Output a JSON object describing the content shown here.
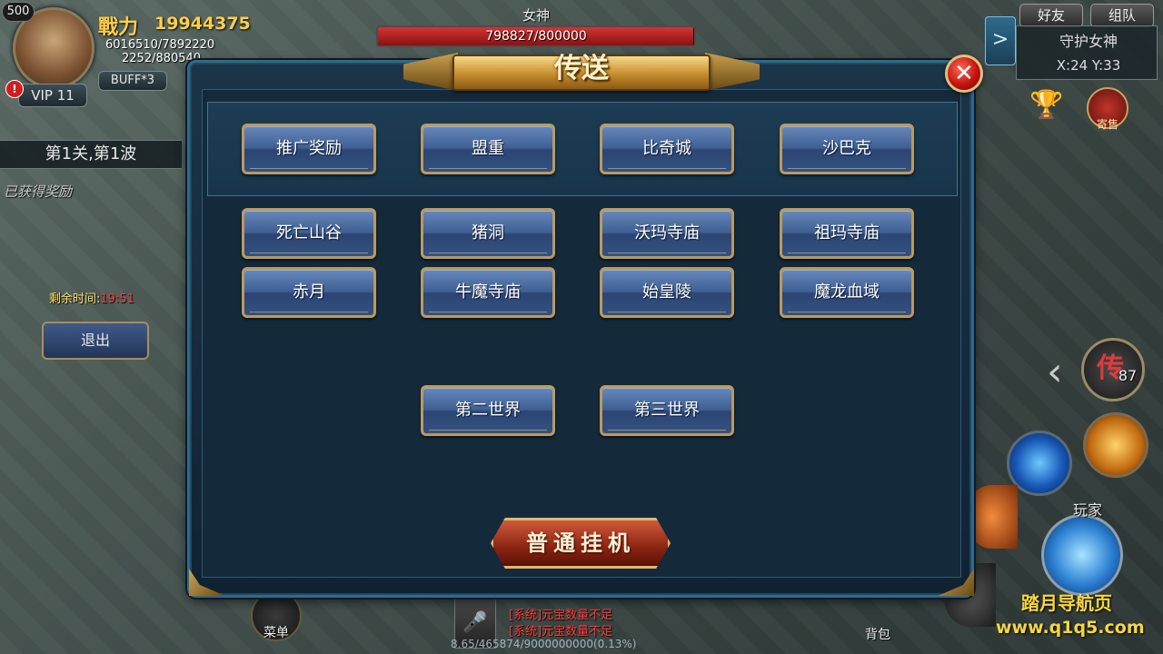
{
  "hud": {
    "level": "500",
    "power_label": "戰力",
    "power_value": "19944375",
    "hp": "6016510/7892220",
    "mp": "2252/880540",
    "vip": "VIP 11",
    "vip_alert": "!",
    "buff": "BUFF*3"
  },
  "boss": {
    "name": "女神",
    "hp_text": "798827/800000",
    "hp_fraction": 0.9985
  },
  "left_panel": {
    "stage": "第1关,第1波",
    "reward_status": "已获得奖励",
    "time_label": "剩余时间:",
    "time_value": "19:51",
    "exit_label": "退出"
  },
  "right_hud": {
    "friends": "好友",
    "team": "组队",
    "map_toggle": ">",
    "map_name": "守护女神",
    "coords": "X:24 Y:33",
    "consign_label": "寄售",
    "teleport_glyph": "传",
    "teleport_count": "87",
    "player_label": "玩家"
  },
  "dialog": {
    "title": "传送",
    "close_symbol": "✕",
    "top_row": [
      "推广奖励",
      "盟重",
      "比奇城",
      "沙巴克"
    ],
    "row2": [
      "死亡山谷",
      "猪洞",
      "沃玛寺庙",
      "祖玛寺庙"
    ],
    "row3": [
      "赤月",
      "牛魔寺庙",
      "始皇陵",
      "魔龙血域"
    ],
    "row4": [
      "第二世界",
      "第三世界"
    ],
    "hangup_label": "普通挂机"
  },
  "bottom": {
    "menu_label": "菜单",
    "bag_label": "背包",
    "chat": [
      "[系统]元宝数量不足",
      "[系统]元宝数量不足"
    ],
    "exp_text": "8.65/465874/9000000000(0.13%)"
  },
  "watermark": {
    "line1": "踏月导航页",
    "line2": "www.q1q5.com"
  },
  "colors": {
    "gold": "#ffcf4a",
    "button_blue": "#3f5f92",
    "button_border": "#b99a62",
    "close_red": "#c4140e",
    "dialog_bg": "#142a3a"
  }
}
